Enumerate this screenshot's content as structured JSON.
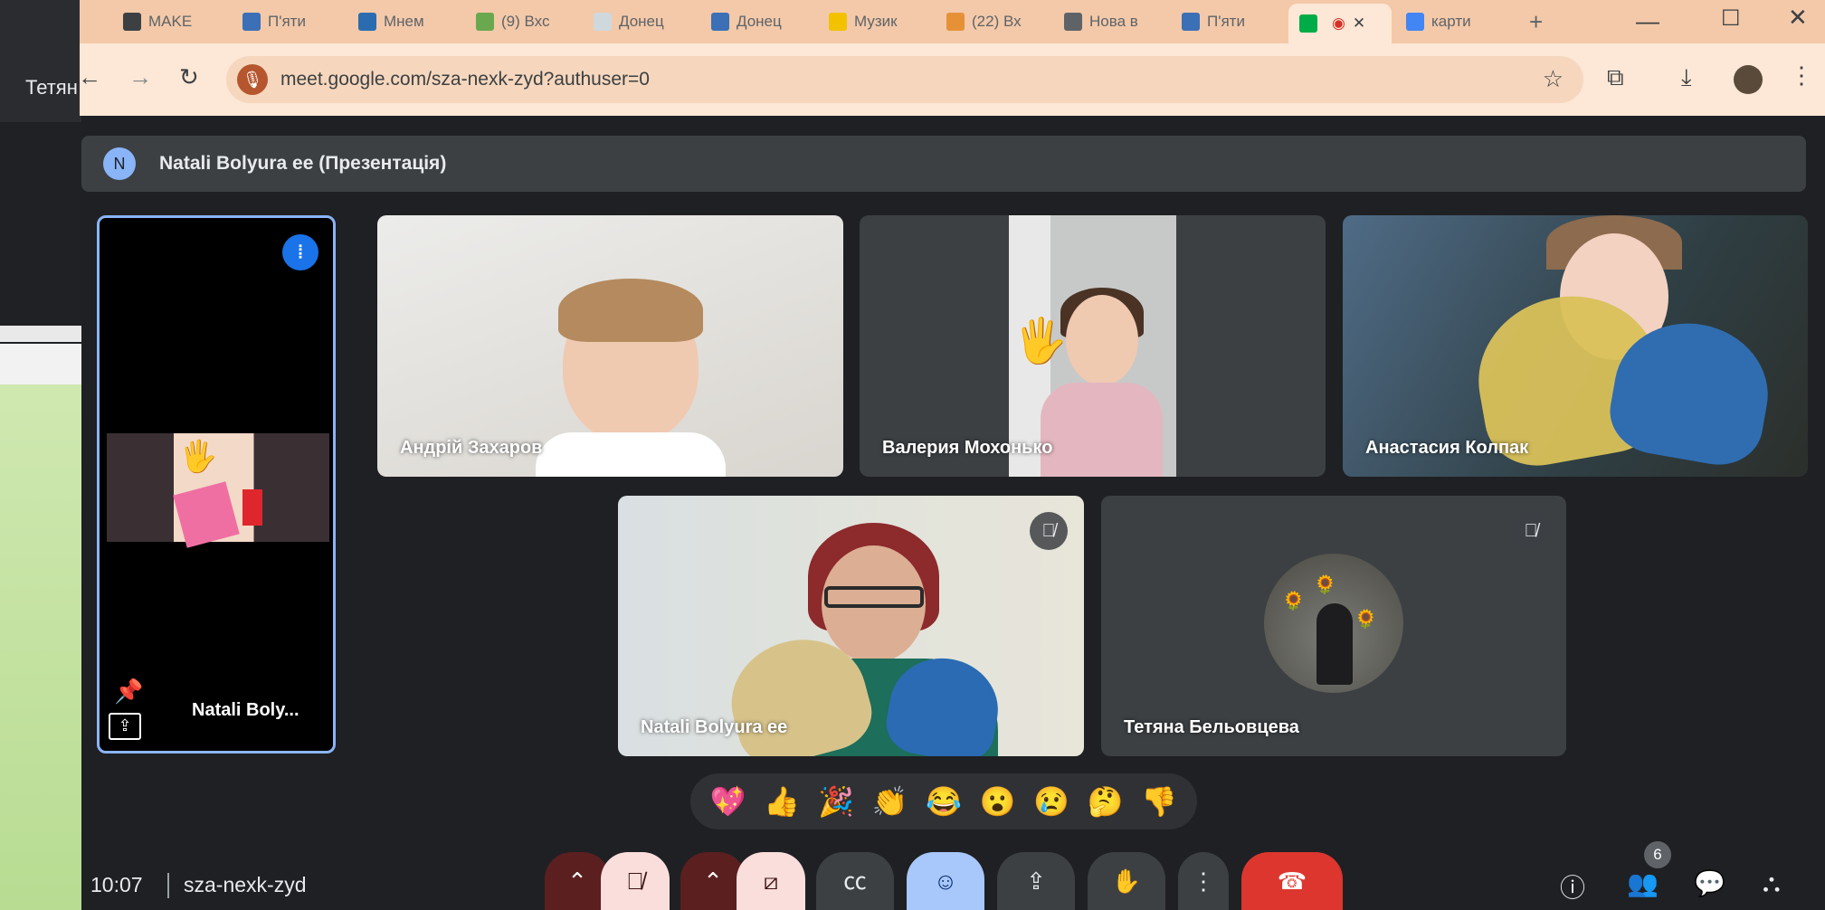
{
  "left_window": {
    "title_fragment": "Тетян"
  },
  "browser": {
    "tabs": [
      {
        "label": "MAKE",
        "fav_color": "#3c4043"
      },
      {
        "label": "П'яти",
        "fav_color": "#3b6fb6"
      },
      {
        "label": "Мнем",
        "fav_color": "#2b6cb0"
      },
      {
        "label": "(9) Вхс",
        "fav_color": "#6aa84f"
      },
      {
        "label": "Донец",
        "fav_color": "#cfd8dc"
      },
      {
        "label": "Донец",
        "fav_color": "#3b6fb6"
      },
      {
        "label": "Музик",
        "fav_color": "#f2c200"
      },
      {
        "label": "(22) Вх",
        "fav_color": "#e69138"
      },
      {
        "label": "Нова в",
        "fav_color": "#5f6368"
      },
      {
        "label": "П'яти",
        "fav_color": "#3b6fb6"
      },
      {
        "label": "",
        "fav_color": "#00ac47",
        "active": true
      },
      {
        "label": "карти",
        "fav_color": "#4285f4"
      }
    ],
    "new_tab": "+",
    "url": "meet.google.com/sza-nexk-zyd?authuser=0"
  },
  "meet": {
    "presentation_header": {
      "avatar_letter": "N",
      "title": "Natali Bolyura ee (Презентація)"
    },
    "self_tile": {
      "name": "Natali Boly..."
    },
    "participants": [
      {
        "id": "andrii",
        "name": "Андрій Захаров",
        "muted": false
      },
      {
        "id": "valeria",
        "name": "Валерия Мохонько",
        "muted": false
      },
      {
        "id": "anastasia",
        "name": "Анастасия Колпак",
        "muted": false
      },
      {
        "id": "natali",
        "name": "Natali Bolyura ee",
        "muted": true
      },
      {
        "id": "tetiana",
        "name": "Тетяна Бельовцева",
        "muted": true
      }
    ],
    "reactions": [
      "💖",
      "👍",
      "🎉",
      "👏",
      "😂",
      "😮",
      "😢",
      "🤔",
      "👎"
    ],
    "time": "10:07",
    "code": "sza-nexk-zyd",
    "people_count": "6"
  }
}
